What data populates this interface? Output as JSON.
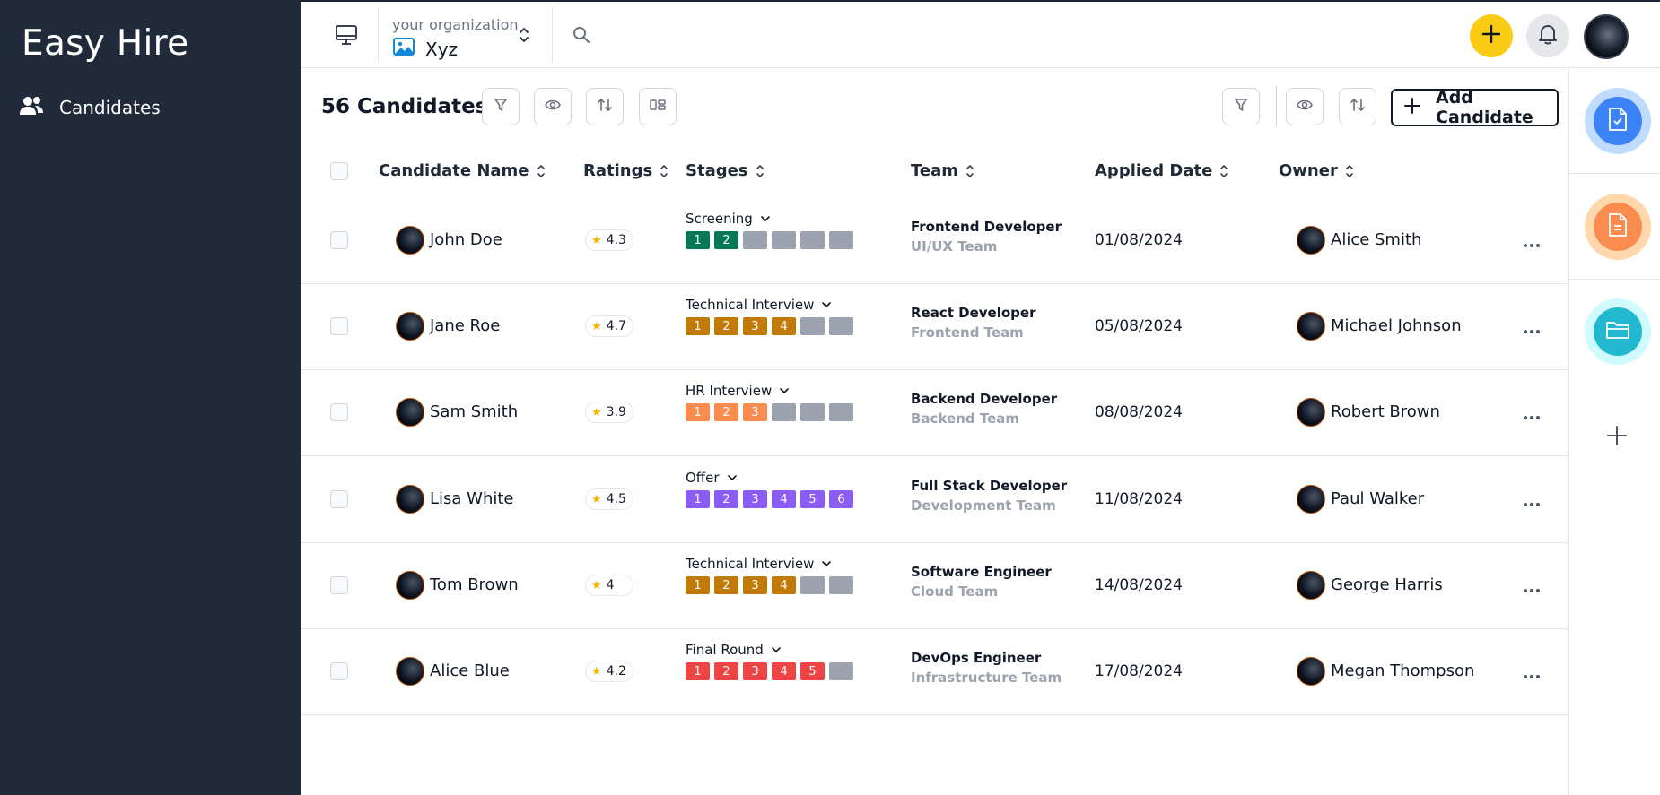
{
  "app": {
    "brand": "Easy Hire",
    "nav": [
      {
        "label": "Candidates",
        "icon": "users-icon"
      }
    ]
  },
  "topbar": {
    "org_caption": "your organization",
    "org_name": "Xyz"
  },
  "toolbar": {
    "title": "56 Candidates",
    "add_label": "Add Candidate"
  },
  "table": {
    "columns": [
      "Candidate Name",
      "Ratings",
      "Stages",
      "Team",
      "Applied Date",
      "Owner"
    ],
    "rows": [
      {
        "name": "John Doe",
        "rating": "4.3",
        "stage": "Screening",
        "stage_color": "#047857",
        "stage_filled": 2,
        "role": "Frontend Developer",
        "team": "UI/UX Team",
        "applied": "01/08/2024",
        "owner": "Alice Smith"
      },
      {
        "name": "Jane Roe",
        "rating": "4.7",
        "stage": "Technical Interview",
        "stage_color": "#c27a06",
        "stage_filled": 4,
        "role": "React Developer",
        "team": "Frontend Team",
        "applied": "05/08/2024",
        "owner": "Michael Johnson"
      },
      {
        "name": "Sam Smith",
        "rating": "3.9",
        "stage": "HR Interview",
        "stage_color": "#fb8c4f",
        "stage_filled": 3,
        "role": "Backend Developer",
        "team": "Backend Team",
        "applied": "08/08/2024",
        "owner": "Robert Brown"
      },
      {
        "name": "Lisa White",
        "rating": "4.5",
        "stage": "Offer",
        "stage_color": "#8b5cf6",
        "stage_filled": 6,
        "role": "Full Stack Developer",
        "team": "Development Team",
        "applied": "11/08/2024",
        "owner": "Paul Walker"
      },
      {
        "name": "Tom Brown",
        "rating": "4",
        "stage": "Technical Interview",
        "stage_color": "#c27a06",
        "stage_filled": 4,
        "role": "Software Engineer",
        "team": "Cloud Team",
        "applied": "14/08/2024",
        "owner": "George Harris"
      },
      {
        "name": "Alice Blue",
        "rating": "4.2",
        "stage": "Final Round",
        "stage_color": "#ef4444",
        "stage_filled": 5,
        "role": "DevOps Engineer",
        "team": "Infrastructure Team",
        "applied": "17/08/2024",
        "owner": "Megan Thompson"
      }
    ]
  },
  "stage_steps": [
    "1",
    "2",
    "3",
    "4",
    "5",
    "6"
  ],
  "colors": {
    "sidebar_bg": "#212a3b",
    "accent_yellow": "#facc15",
    "empty_stage": "#9ca3af",
    "rail_blue": "#3b82f6",
    "rail_orange": "#fb8c4f",
    "rail_cyan": "#22b8cf"
  }
}
